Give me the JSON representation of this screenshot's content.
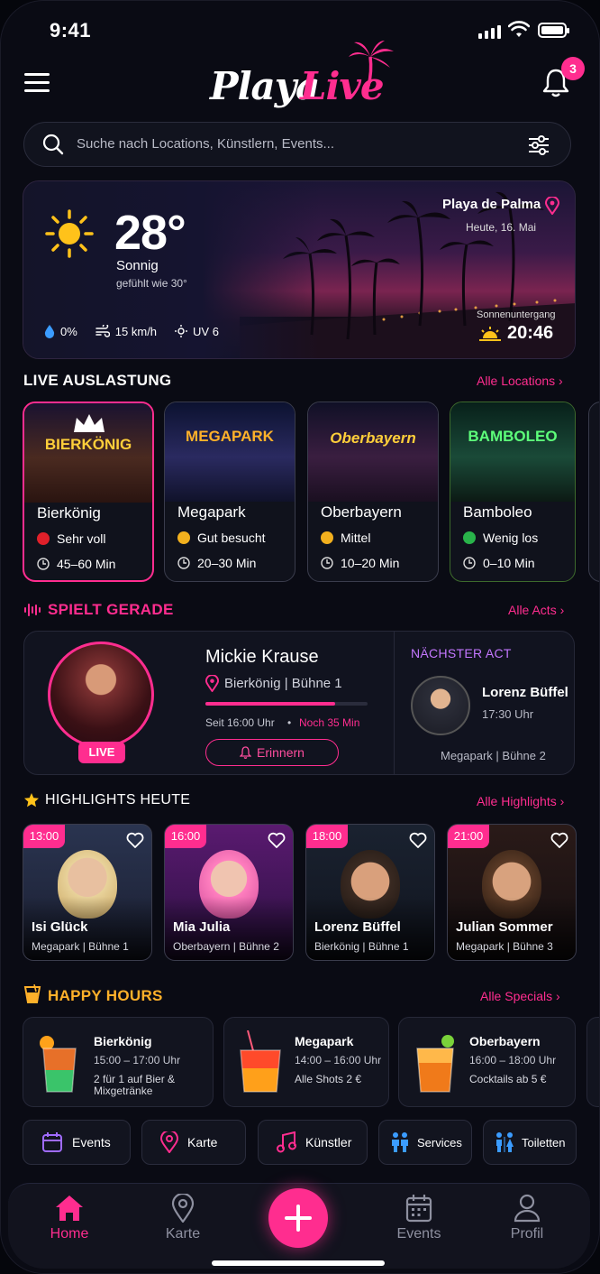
{
  "status": {
    "time": "9:41"
  },
  "header": {
    "logo_part1": "Playa",
    "logo_part2": "Live",
    "notifications": "3"
  },
  "search": {
    "placeholder": "Suche nach Locations, Künstlern, Events..."
  },
  "weather": {
    "temp": "28°",
    "condition": "Sonnig",
    "feels": "gefühlt wie 30°",
    "rain": "0%",
    "wind": "15 km/h",
    "uv": "UV 6",
    "location": "Playa de Palma",
    "date": "Heute, 16. Mai",
    "sunset_label": "Sonnenuntergang",
    "sunset": "20:46"
  },
  "occupancy": {
    "title": "LIVE AUSLASTUNG",
    "link": "Alle Locations",
    "venues": [
      {
        "sign": "BIERKÖNIG",
        "name": "Bierkönig",
        "level": "Sehr voll",
        "level_color": "#e0202a",
        "wait": "45–60 Min",
        "accent": "#ff2d8f"
      },
      {
        "sign": "MEGAPARK",
        "name": "Megapark",
        "level": "Gut besucht",
        "level_color": "#f2b01e",
        "wait": "20–30 Min",
        "accent": "#3a3c4c"
      },
      {
        "sign": "Oberbayern",
        "name": "Oberbayern",
        "level": "Mittel",
        "level_color": "#f2b01e",
        "wait": "10–20 Min",
        "accent": "#3a3c4c"
      },
      {
        "sign": "BAMBOLEO",
        "name": "Bamboleo",
        "level": "Wenig los",
        "level_color": "#29b34a",
        "wait": "0–10 Min",
        "accent": "#3a3c4c"
      }
    ]
  },
  "playing": {
    "title": "SPIELT GERADE",
    "link": "Alle Acts",
    "live": "LIVE",
    "name": "Mickie Krause",
    "location": "Bierkönig | Bühne 1",
    "progress": 0.8,
    "since": "Seit 16:00 Uhr",
    "remaining": "Noch 35 Min",
    "remind": "Erinnern",
    "next_label": "NÄCHSTER ACT",
    "next_name": "Lorenz Büffel",
    "next_time": "17:30 Uhr",
    "next_venue": "Megapark | Bühne 2"
  },
  "highlights": {
    "title": "HIGHLIGHTS HEUTE",
    "link": "Alle Highlights",
    "items": [
      {
        "time": "13:00",
        "name": "Isi Glück",
        "venue": "Megapark | Bühne 1"
      },
      {
        "time": "16:00",
        "name": "Mia Julia",
        "venue": "Oberbayern | Bühne 2"
      },
      {
        "time": "18:00",
        "name": "Lorenz Büffel",
        "venue": "Bierkönig | Bühne 1"
      },
      {
        "time": "21:00",
        "name": "Julian Sommer",
        "venue": "Megapark | Bühne 3"
      }
    ]
  },
  "happy": {
    "title": "HAPPY HOURS",
    "link": "Alle Specials",
    "items": [
      {
        "name": "Bierkönig",
        "time": "15:00 – 17:00 Uhr",
        "deal": "2 für 1 auf Bier & Mixgetränke"
      },
      {
        "name": "Megapark",
        "time": "14:00 – 16:00 Uhr",
        "deal": "Alle Shots 2 €"
      },
      {
        "name": "Oberbayern",
        "time": "16:00 – 18:00 Uhr",
        "deal": "Cocktails ab 5 €"
      }
    ]
  },
  "quicklinks": [
    "Events",
    "Karte",
    "Künstler",
    "Services",
    "Toiletten"
  ],
  "nav": {
    "home": "Home",
    "map": "Karte",
    "events": "Events",
    "profile": "Profil"
  }
}
